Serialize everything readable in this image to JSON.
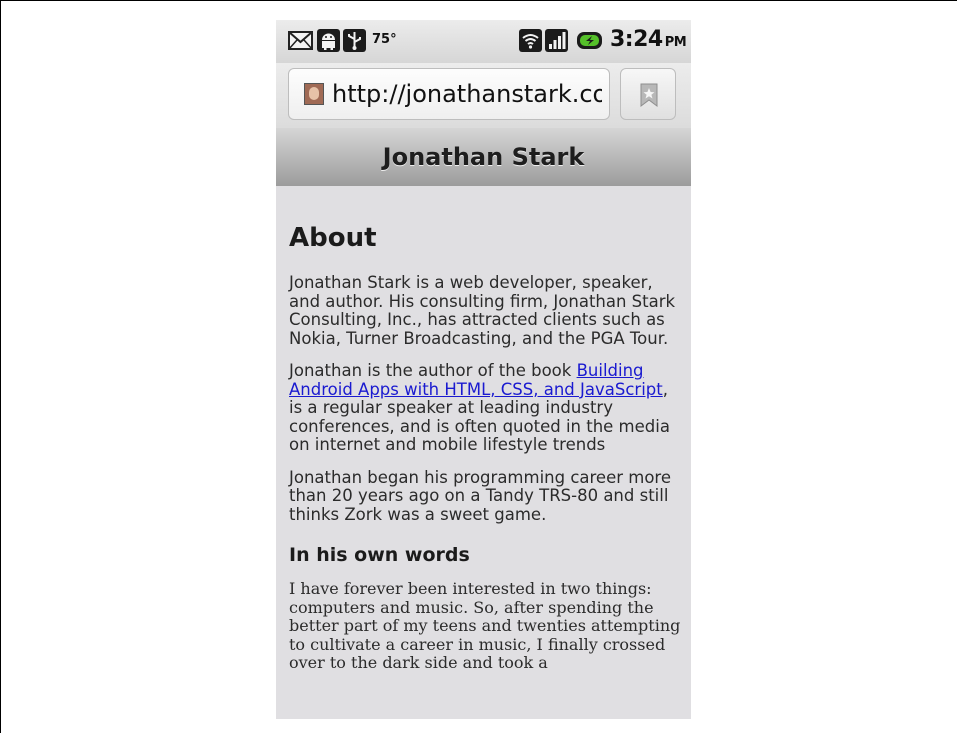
{
  "status_bar": {
    "temperature": "75°",
    "time": "3:24",
    "ampm": "PM",
    "icons": [
      "gmail-icon",
      "android-debug-icon",
      "usb-icon",
      "wifi-icon",
      "signal-icon",
      "battery-charging-icon"
    ]
  },
  "browser": {
    "url": "http://jonathanstark.co...",
    "favicon": "favicon-icon",
    "bookmark_icon": "bookmark-star-icon"
  },
  "page": {
    "header_title": "Jonathan Stark",
    "heading": "About",
    "para1": "Jonathan Stark is a web developer, speaker, and author. His consulting firm, Jonathan Stark Consulting, Inc., has attracted clients such as Nokia, Turner Broadcasting, and the PGA Tour.",
    "para2_before": "Jonathan is the author of the book ",
    "para2_link": "Building Android Apps with HTML, CSS, and JavaScript",
    "para2_after": ", is a regular speaker at leading industry conferences, and is often quoted in the media on internet and mobile lifestyle trends",
    "para3": "Jonathan began his programming career more than 20 years ago on a Tandy TRS-80 and still thinks Zork was a sweet game.",
    "subheading": "In his own words",
    "para4": "I have forever been interested in two things: computers and music. So, after spending the better part of my teens and twenties attempting to cultivate a career in music, I finally crossed over to the dark side and took a"
  },
  "colors": {
    "link": "#1a1ad0",
    "page_background": "#e0dfe2",
    "header_gradient_top": "#d6d6d6",
    "header_gradient_bottom": "#9c9c9c"
  }
}
